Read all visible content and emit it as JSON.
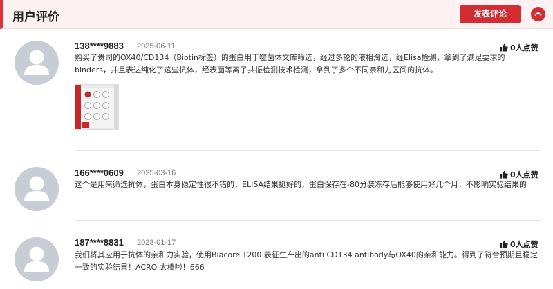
{
  "header": {
    "title": "用户评价",
    "post_button": "发表评论",
    "collapse_icon": "chevron-up-icon",
    "accent_color": "#d12d33"
  },
  "reviews": [
    {
      "user": "138****9883",
      "date": "2025-06-11",
      "likes": "0人点赞",
      "content": "购买了贵司的OX40/CD134（Biotin标签）的蛋白用于噬菌体文库筛选，经过多轮的液相淘选，经Elisa检测，拿到了满足要求的binders，并且表达纯化了这些抗体，经表面等离子共振检测技术检测，拿到了多个不同亲和力区间的抗体。",
      "has_image": true
    },
    {
      "user": "166****0609",
      "date": "2025-03-16",
      "likes": "0人点赞",
      "content": "这个是用来筛选抗体，蛋白本身稳定性很不错的，ELISA结果挺好的，蛋白保存在-80分装冻存后能够使用好几个月，不影响实验结果的"
    },
    {
      "user": "187****8831",
      "date": "2023-01-17",
      "likes": "0人点赞",
      "content": "我们将其应用于抗体的亲和力实验，使用Biacore T200 表征生产出的anti CD134 antibody与OX40的亲和能力。得到了符合预期且稳定一致的实验结果！ACRO 太棒啦！666"
    }
  ]
}
